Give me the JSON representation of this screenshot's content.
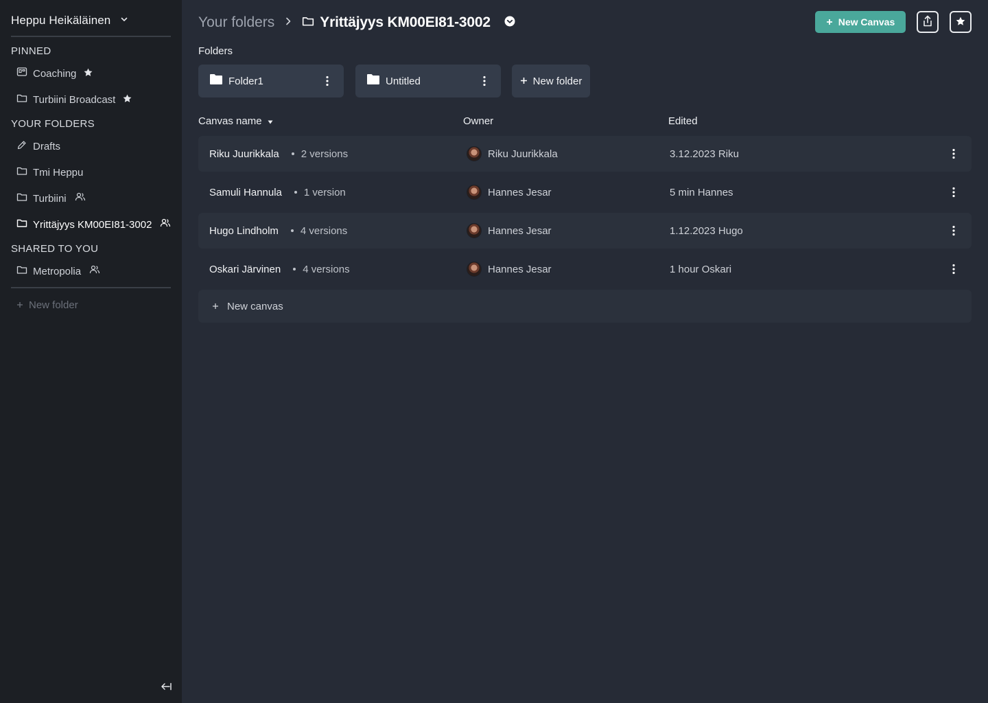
{
  "sidebar": {
    "user_name": "Heppu Heikäläinen",
    "sections": {
      "pinned": "PINNED",
      "your_folders": "YOUR FOLDERS",
      "shared": "SHARED TO YOU"
    },
    "pinned": [
      {
        "label": "Coaching",
        "icon": "board-icon"
      },
      {
        "label": "Turbiini Broadcast",
        "icon": "folder-icon"
      }
    ],
    "folders": [
      {
        "label": "Drafts",
        "icon": "pencil-icon"
      },
      {
        "label": "Tmi Heppu",
        "icon": "folder-icon"
      },
      {
        "label": "Turbiini",
        "icon": "folder-icon",
        "shared": true
      },
      {
        "label": "Yrittäjyys KM00EI81-3002",
        "icon": "folder-icon",
        "shared": true,
        "active": true
      }
    ],
    "shared_to_you": [
      {
        "label": "Metropolia",
        "icon": "folder-icon",
        "shared": true
      }
    ],
    "new_folder": "New folder"
  },
  "header": {
    "breadcrumb_root": "Your folders",
    "breadcrumb_current": "Yrittäjyys KM00EI81-3002",
    "new_canvas_label": "New Canvas"
  },
  "folders_section": {
    "label": "Folders",
    "items": [
      {
        "name": "Folder1"
      },
      {
        "name": "Untitled"
      }
    ],
    "new_folder_label": "New folder"
  },
  "table": {
    "columns": {
      "name": "Canvas name",
      "owner": "Owner",
      "edited": "Edited"
    },
    "rows": [
      {
        "name": "Riku Juurikkala",
        "versions": "2 versions",
        "owner": "Riku Juurikkala",
        "edited": "3.12.2023 Riku"
      },
      {
        "name": "Samuli Hannula",
        "versions": "1 version",
        "owner": "Hannes Jesar",
        "edited": "5 min Hannes"
      },
      {
        "name": "Hugo Lindholm",
        "versions": "4 versions",
        "owner": "Hannes Jesar",
        "edited": "1.12.2023 Hugo"
      },
      {
        "name": "Oskari Järvinen",
        "versions": "4 versions",
        "owner": "Hannes Jesar",
        "edited": "1 hour Oskari"
      }
    ],
    "new_canvas_label": "New canvas"
  },
  "colors": {
    "sidebar_bg": "#1c1f24",
    "main_bg": "#262b36",
    "card_bg": "#343c4a",
    "accent": "#4aa89b"
  }
}
